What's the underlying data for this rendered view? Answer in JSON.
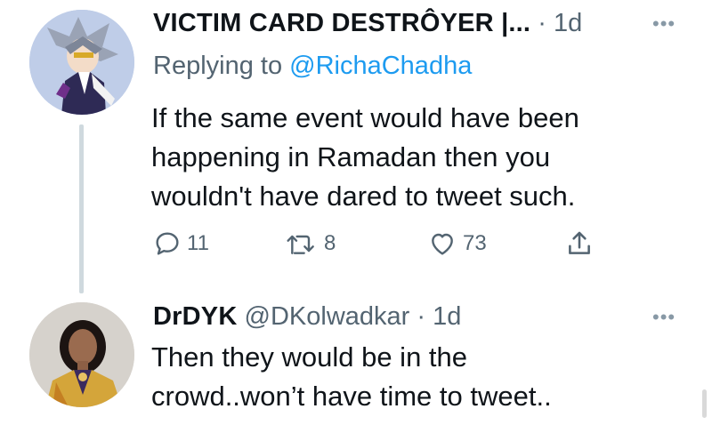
{
  "tweets": [
    {
      "name": "VICTIM CARD DESTRÔYER |...",
      "time": "· 1d",
      "more": "•••",
      "replying_prefix": "Replying to ",
      "replying_handle": "@RichaChadha",
      "lines": [
        "If the same event would have been",
        "happening in Ramadan then you",
        "wouldn't have dared to tweet such."
      ],
      "stats": {
        "replies": "11",
        "retweets": "8",
        "likes": "73"
      }
    },
    {
      "name": "DrDYK",
      "handle": "@DKolwadkar",
      "time": "· 1d",
      "more": "•••",
      "lines": [
        "Then they would be in the",
        "crowd..won’t have time to tweet.."
      ]
    }
  ],
  "colors": {
    "link": "#1d9bf0",
    "muted": "#536471",
    "thread_line": "#cfd9de"
  }
}
